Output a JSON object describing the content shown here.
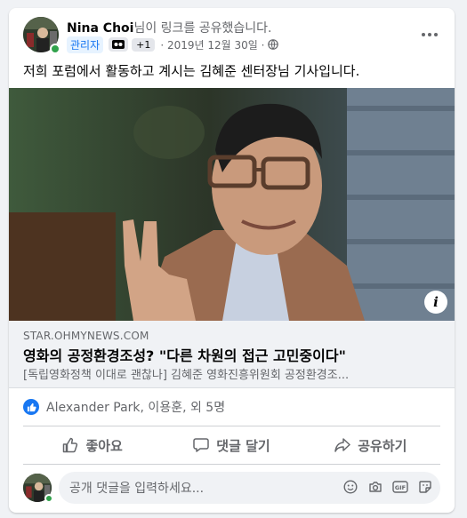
{
  "post": {
    "author": "Nina Choi",
    "action_text": "님이 링크를 공유했습니다.",
    "admin_badge": "관리자",
    "plus_badge": "+1",
    "date": "· 2019년 12월 30일 ·",
    "body": "저희 포럼에서 활동하고 계시는 김혜준 센터장님 기사입니다."
  },
  "link": {
    "domain": "STAR.OHMYNEWS.COM",
    "title": "영화의 공정환경조성? \"다른 차원의 접근 고민중이다\"",
    "description": "[독립영화정책 이대로 괜찮나] 김혜준 영화진흥위원회 공정환경조..."
  },
  "reactions": {
    "text": "Alexander Park, 이용훈, 외 5명"
  },
  "actions": {
    "like": "좋아요",
    "comment": "댓글 달기",
    "share": "공유하기"
  },
  "comment_box": {
    "placeholder": "공개 댓글을 입력하세요..."
  },
  "colors": {
    "accent": "#1877f2",
    "online": "#31a24c",
    "muted_text": "#65676b"
  }
}
